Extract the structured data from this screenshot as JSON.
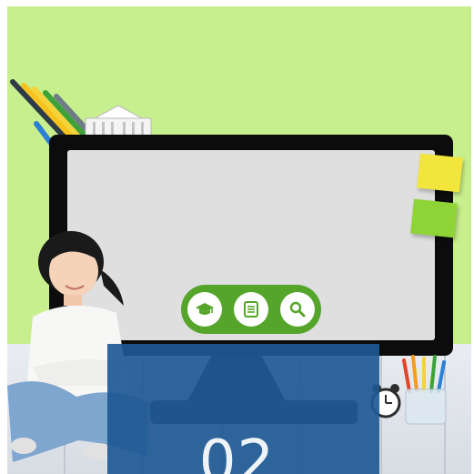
{
  "scene": {
    "number": "02",
    "colors": {
      "wall": "#c8ef8d",
      "floor": "#e3e7ec",
      "monitor_frame": "#0c0c0c",
      "monitor_screen": "#dfdfdf",
      "icon_pill": "#55a52a",
      "note_yellow": "#f2e53b",
      "note_green": "#8ed437",
      "overlay": "#1e5994"
    },
    "screen_icons": [
      {
        "name": "graduation-cap-icon"
      },
      {
        "name": "document-list-icon"
      },
      {
        "name": "search-icon"
      }
    ]
  }
}
